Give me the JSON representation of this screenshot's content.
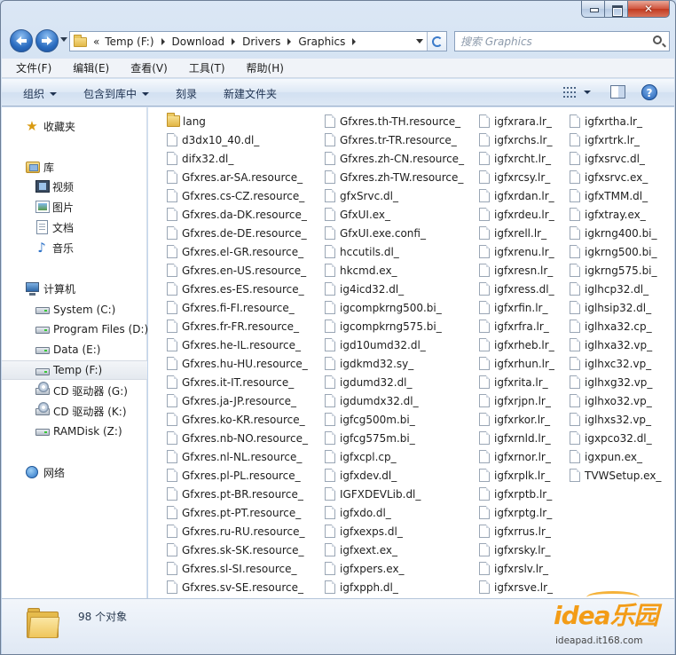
{
  "window": {
    "close_glyph": "✕"
  },
  "address": {
    "overflow": "«",
    "crumbs": [
      "Temp (F:)",
      "Download",
      "Drivers",
      "Graphics"
    ]
  },
  "search": {
    "placeholder": "搜索 Graphics"
  },
  "menu": [
    "文件(F)",
    "编辑(E)",
    "查看(V)",
    "工具(T)",
    "帮助(H)"
  ],
  "toolbar": {
    "organize": "组织",
    "include_library": "包含到库中",
    "burn": "刻录",
    "new_folder": "新建文件夹",
    "help": "?"
  },
  "sidebar": {
    "favorites": "收藏夹",
    "libraries": "库",
    "videos": "视频",
    "pictures": "图片",
    "documents": "文档",
    "music": "音乐",
    "computer": "计算机",
    "drives": [
      "System (C:)",
      "Program Files (D:)",
      "Data (E:)",
      "Temp (F:)",
      "CD 驱动器 (G:)",
      "CD 驱动器 (K:)",
      "RAMDisk (Z:)"
    ],
    "network": "网络",
    "selected": "Temp (F:)"
  },
  "files": {
    "col1": [
      "lang",
      "d3dx10_40.dl_",
      "difx32.dl_",
      "Gfxres.ar-SA.resource_",
      "Gfxres.cs-CZ.resource_",
      "Gfxres.da-DK.resource_",
      "Gfxres.de-DE.resource_",
      "Gfxres.el-GR.resource_",
      "Gfxres.en-US.resource_",
      "Gfxres.es-ES.resource_",
      "Gfxres.fi-FI.resource_",
      "Gfxres.fr-FR.resource_",
      "Gfxres.he-IL.resource_",
      "Gfxres.hu-HU.resource_",
      "Gfxres.it-IT.resource_",
      "Gfxres.ja-JP.resource_",
      "Gfxres.ko-KR.resource_",
      "Gfxres.nb-NO.resource_",
      "Gfxres.nl-NL.resource_",
      "Gfxres.pl-PL.resource_",
      "Gfxres.pt-BR.resource_",
      "Gfxres.pt-PT.resource_",
      "Gfxres.ru-RU.resource_",
      "Gfxres.sk-SK.resource_",
      "Gfxres.sl-SI.resource_",
      "Gfxres.sv-SE.resource_"
    ],
    "col2": [
      "Gfxres.th-TH.resource_",
      "Gfxres.tr-TR.resource_",
      "Gfxres.zh-CN.resource_",
      "Gfxres.zh-TW.resource_",
      "gfxSrvc.dl_",
      "GfxUI.ex_",
      "GfxUI.exe.confi_",
      "hccutils.dl_",
      "hkcmd.ex_",
      "ig4icd32.dl_",
      "igcompkrng500.bi_",
      "igcompkrng575.bi_",
      "igd10umd32.dl_",
      "igdkmd32.sy_",
      "igdumd32.dl_",
      "igdumdx32.dl_",
      "igfcg500m.bi_",
      "igfcg575m.bi_",
      "igfxcpl.cp_",
      "igfxdev.dl_",
      "IGFXDEVLib.dl_",
      "igfxdo.dl_",
      "igfxexps.dl_",
      "igfxext.ex_",
      "igfxpers.ex_",
      "igfxpph.dl_"
    ],
    "col3": [
      "igfxrara.lr_",
      "igfxrchs.lr_",
      "igfxrcht.lr_",
      "igfxrcsy.lr_",
      "igfxrdan.lr_",
      "igfxrdeu.lr_",
      "igfxrell.lr_",
      "igfxrenu.lr_",
      "igfxresn.lr_",
      "igfxress.dl_",
      "igfxrfin.lr_",
      "igfxrfra.lr_",
      "igfxrheb.lr_",
      "igfxrhun.lr_",
      "igfxrita.lr_",
      "igfxrjpn.lr_",
      "igfxrkor.lr_",
      "igfxrnld.lr_",
      "igfxrnor.lr_",
      "igfxrplk.lr_",
      "igfxrptb.lr_",
      "igfxrptg.lr_",
      "igfxrrus.lr_",
      "igfxrsky.lr_",
      "igfxrslv.lr_",
      "igfxrsve.lr_"
    ],
    "col4": [
      "igfxrtha.lr_",
      "igfxrtrk.lr_",
      "igfxsrvc.dl_",
      "igfxsrvc.ex_",
      "igfxTMM.dl_",
      "igfxtray.ex_",
      "igkrng400.bi_",
      "igkrng500.bi_",
      "igkrng575.bi_",
      "iglhcp32.dl_",
      "iglhsip32.dl_",
      "iglhxa32.cp_",
      "iglhxa32.vp_",
      "iglhxc32.vp_",
      "iglhxg32.vp_",
      "iglhxo32.vp_",
      "iglhxs32.vp_",
      "igxpco32.dl_",
      "igxpun.ex_",
      "TVWSetup.ex_"
    ]
  },
  "status": {
    "item_count": "98 个对象"
  },
  "watermark": {
    "logo": "idea乐园",
    "site": "ideapad.it168.com"
  },
  "colors": {
    "window_frame": "#c4d6ec",
    "selection_bg": "#e4e9ef",
    "watermark_orange": "#f39c17"
  }
}
